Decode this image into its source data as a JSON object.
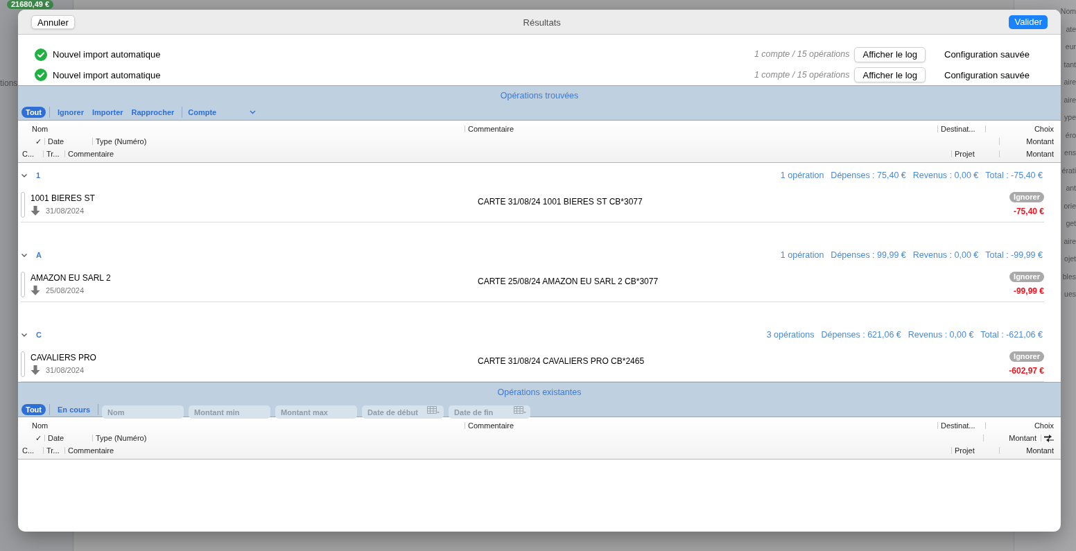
{
  "background": {
    "balance_badge": "21680,49 €",
    "left_fragment": "tions",
    "right_fragments": [
      "Nom",
      "ate",
      "eur",
      "tant",
      "aire",
      "aire",
      "ype",
      "éro",
      "ens",
      "érati",
      "ant",
      "orie",
      "get",
      "aire",
      "ojet",
      "bles",
      "ues"
    ]
  },
  "sheet": {
    "cancel": "Annuler",
    "title": "Résultats",
    "confirm": "Valider"
  },
  "imports": [
    {
      "name": "Nouvel import automatique",
      "summary": "1 compte / 15 opérations",
      "log_button": "Afficher le log",
      "status": "Configuration sauvée"
    },
    {
      "name": "Nouvel import automatique",
      "summary": "1 compte / 15 opérations",
      "log_button": "Afficher le log",
      "status": "Configuration sauvée"
    }
  ],
  "found": {
    "title": "Opérations trouvées",
    "filters": [
      {
        "label": "Tout",
        "selected": true
      },
      {
        "label": "Ignorer",
        "selected": false
      },
      {
        "label": "Importer",
        "selected": false
      },
      {
        "label": "Rapprocher",
        "selected": false
      }
    ],
    "dropdown": {
      "label": "Compte"
    },
    "header_rows": [
      [
        "Nom",
        "Commentaire",
        "Destinat...",
        "Choix"
      ],
      [
        "✓",
        "Date",
        "Type (Numéro)",
        "Montant"
      ],
      [
        "C...",
        "Tr...",
        "Commentaire",
        "Projet",
        "Montant"
      ]
    ],
    "groups": [
      {
        "label": "1",
        "expanded": true,
        "summary": [
          "1 opération",
          "Dépenses : 75,40 €",
          "Revenus : 0,00 €",
          "Total : -75,40 €"
        ],
        "operations": [
          {
            "name": "1001 BIERES ST",
            "date": "31/08/2024",
            "comment": "CARTE 31/08/24 1001 BIERES ST CB*3077",
            "action": "Ignorer",
            "amount": "-75,40 €"
          }
        ]
      },
      {
        "label": "A",
        "expanded": true,
        "summary": [
          "1 opération",
          "Dépenses : 99,99 €",
          "Revenus : 0,00 €",
          "Total : -99,99 €"
        ],
        "operations": [
          {
            "name": "AMAZON EU SARL 2",
            "date": "25/08/2024",
            "comment": "CARTE 25/08/24 AMAZON EU SARL 2 CB*3077",
            "action": "Ignorer",
            "amount": "-99,99 €"
          }
        ]
      },
      {
        "label": "C",
        "expanded": true,
        "summary": [
          "3 opérations",
          "Dépenses : 621,06 €",
          "Revenus : 0,00 €",
          "Total : -621,06 €"
        ],
        "operations": [
          {
            "name": "CAVALIERS PRO",
            "date": "31/08/2024",
            "comment": "CARTE 31/08/24 CAVALIERS PRO CB*2465",
            "action": "Ignorer",
            "amount": "-602,97 €"
          }
        ]
      }
    ]
  },
  "existing": {
    "title": "Opérations existantes",
    "filters": [
      {
        "label": "Tout",
        "selected": true
      },
      {
        "label": "En cours",
        "selected": false
      }
    ],
    "fields": [
      {
        "kind": "text",
        "placeholder": "Nom"
      },
      {
        "kind": "text",
        "placeholder": "Montant min"
      },
      {
        "kind": "text",
        "placeholder": "Montant max"
      },
      {
        "kind": "date",
        "placeholder": "Date de début"
      },
      {
        "kind": "date",
        "placeholder": "Date de fin"
      }
    ],
    "header_rows": [
      [
        "Nom",
        "Commentaire",
        "Destinat...",
        "Choix"
      ],
      [
        "✓",
        "Date",
        "Type (Numéro)",
        "Montant"
      ],
      [
        "C...",
        "Tr...",
        "Commentaire",
        "Projet",
        "Montant"
      ]
    ],
    "swap_column": true
  }
}
